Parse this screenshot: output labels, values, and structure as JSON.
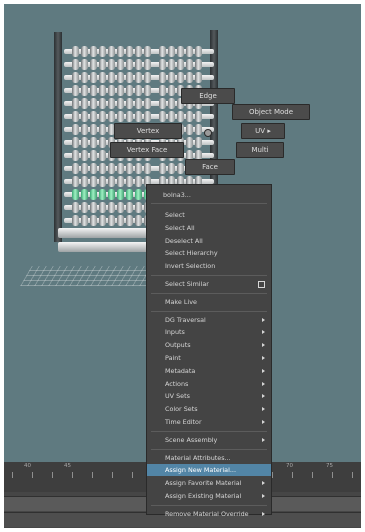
{
  "marking_menu": {
    "edge": "Edge",
    "object_mode": "Object Mode",
    "uv": "UV",
    "vertex": "Vertex",
    "vertex_face": "Vertex Face",
    "multi": "Multi",
    "face": "Face"
  },
  "context_menu": {
    "title": "bolna3...",
    "items": [
      {
        "label": "Select",
        "submenu": false
      },
      {
        "label": "Select All",
        "submenu": false
      },
      {
        "label": "Deselect All",
        "submenu": false
      },
      {
        "label": "Select Hierarchy",
        "submenu": false
      },
      {
        "label": "Invert Selection",
        "submenu": false
      },
      {
        "label": "Select Similar",
        "submenu": false,
        "option_box": true
      },
      {
        "label": "Make Live",
        "submenu": false
      },
      {
        "label": "DG Traversal",
        "submenu": true
      },
      {
        "label": "Inputs",
        "submenu": true
      },
      {
        "label": "Outputs",
        "submenu": true
      },
      {
        "label": "Paint",
        "submenu": true
      },
      {
        "label": "Metadata",
        "submenu": true
      },
      {
        "label": "Actions",
        "submenu": true
      },
      {
        "label": "UV Sets",
        "submenu": true
      },
      {
        "label": "Color Sets",
        "submenu": true
      },
      {
        "label": "Time Editor",
        "submenu": true
      },
      {
        "label": "Scene Assembly",
        "submenu": true
      },
      {
        "label": "Material Attributes...",
        "submenu": false
      },
      {
        "label": "Assign New Material...",
        "submenu": false,
        "highlighted": true
      },
      {
        "label": "Assign Favorite Material",
        "submenu": true
      },
      {
        "label": "Assign Existing Material",
        "submenu": true
      },
      {
        "label": "Remove Material Override",
        "submenu": true
      }
    ]
  },
  "timeline": {
    "ticks": [
      "40",
      "45",
      "70",
      "75"
    ]
  },
  "colors": {
    "viewport_bg": "#5f7a80",
    "menu_bg": "#444444",
    "highlight": "#5285a6",
    "selected_beads": "#5de69b"
  }
}
